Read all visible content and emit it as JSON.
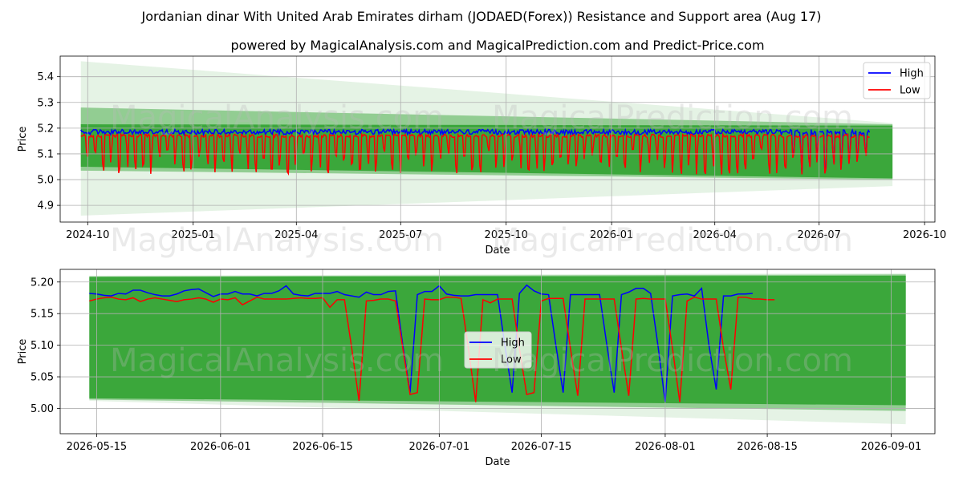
{
  "title": "Jordanian dinar With United Arab Emirates dirham (JODAED(Forex)) Resistance and Support area (Aug 17)",
  "subtitle": "powered by MagicalAnalysis.com and MagicalPrediction.com and Predict-Price.com",
  "watermarks": [
    "MagicalAnalysis.com",
    "MagicalPrediction.com"
  ],
  "colors": {
    "high": "#0000ff",
    "low": "#ff0000",
    "band": "#2ca02c",
    "band_light": "#d4ead4",
    "grid": "#b0b0b0"
  },
  "chart_data": [
    {
      "type": "line",
      "xlabel": "Date",
      "ylabel": "Price",
      "xlim": [
        "2024-09-07",
        "2026-10-10"
      ],
      "ylim": [
        4.835,
        5.48
      ],
      "grid": true,
      "legend_position": "top-right",
      "x_ticks": [
        "2024-10",
        "2025-01",
        "2025-04",
        "2025-07",
        "2025-10",
        "2026-01",
        "2026-04",
        "2026-07",
        "2026-10"
      ],
      "y_ticks": [
        "4.9",
        "5.0",
        "5.1",
        "5.2",
        "5.3",
        "5.4"
      ],
      "series": [
        {
          "name": "High",
          "x_start": "2024-09-25",
          "x_end": "2026-08-14",
          "typical": 5.185,
          "range": [
            5.175,
            5.21
          ]
        },
        {
          "name": "Low",
          "x_start": "2024-09-25",
          "x_end": "2026-08-14",
          "typical": 5.17,
          "range": [
            5.01,
            5.215
          ]
        }
      ],
      "bands": [
        {
          "x": [
            "2024-09-25",
            "2026-09-03"
          ],
          "upper": [
            5.46,
            5.22
          ],
          "lower": [
            4.86,
            4.975
          ],
          "style": "light"
        },
        {
          "x": [
            "2024-09-25",
            "2026-09-03"
          ],
          "upper": [
            5.28,
            5.215
          ],
          "lower": [
            5.035,
            5.0
          ],
          "style": "medium"
        },
        {
          "x": [
            "2024-09-25",
            "2026-09-03"
          ],
          "upper": [
            5.215,
            5.21
          ],
          "lower": [
            5.05,
            5.005
          ],
          "style": "dark"
        }
      ]
    },
    {
      "type": "line",
      "xlabel": "Date",
      "ylabel": "Price",
      "xlim": [
        "2026-05-10",
        "2026-09-07"
      ],
      "ylim": [
        4.96,
        5.22
      ],
      "grid": true,
      "legend_position": "center",
      "x_ticks": [
        "2026-05-15",
        "2026-06-01",
        "2026-06-15",
        "2026-07-01",
        "2026-07-15",
        "2026-08-01",
        "2026-08-15",
        "2026-09-01"
      ],
      "y_ticks": [
        "5.00",
        "5.05",
        "5.10",
        "5.15",
        "5.20"
      ],
      "x_start": "2026-05-14",
      "series": [
        {
          "name": "High",
          "values": [
            5.182,
            5.181,
            5.179,
            5.178,
            5.182,
            5.181,
            5.187,
            5.187,
            5.183,
            5.18,
            5.178,
            5.178,
            5.181,
            5.186,
            5.188,
            5.189,
            5.183,
            5.177,
            5.181,
            5.181,
            5.185,
            5.181,
            5.181,
            5.178,
            5.182,
            5.182,
            5.186,
            5.194,
            5.181,
            5.179,
            5.178,
            5.182,
            5.182,
            5.182,
            5.185,
            5.18,
            5.178,
            5.176,
            5.184,
            5.18,
            5.18,
            5.185,
            5.186,
            5.1,
            5.025,
            5.18,
            5.185,
            5.185,
            5.194,
            5.181,
            5.179,
            5.178,
            5.178,
            5.18,
            5.18,
            5.18,
            5.18,
            5.1,
            5.025,
            5.182,
            5.195,
            5.186,
            5.181,
            5.18,
            5.1,
            5.025,
            5.18,
            5.18,
            5.18,
            5.18,
            5.18,
            5.1,
            5.025,
            5.18,
            5.184,
            5.19,
            5.19,
            5.182,
            5.1,
            5.01,
            5.178,
            5.18,
            5.181,
            5.178,
            5.19,
            5.1,
            5.03,
            5.178,
            5.178,
            5.181,
            5.181,
            5.182
          ]
        },
        {
          "name": "Low",
          "values": [
            5.17,
            5.173,
            5.175,
            5.176,
            5.173,
            5.172,
            5.175,
            5.169,
            5.173,
            5.175,
            5.173,
            5.171,
            5.169,
            5.172,
            5.173,
            5.175,
            5.173,
            5.168,
            5.173,
            5.172,
            5.175,
            5.164,
            5.17,
            5.176,
            5.173,
            5.173,
            5.173,
            5.173,
            5.174,
            5.175,
            5.174,
            5.174,
            5.175,
            5.16,
            5.172,
            5.172,
            5.095,
            5.012,
            5.17,
            5.171,
            5.173,
            5.173,
            5.17,
            5.095,
            5.022,
            5.025,
            5.173,
            5.172,
            5.172,
            5.176,
            5.176,
            5.174,
            5.095,
            5.01,
            5.172,
            5.167,
            5.173,
            5.173,
            5.173,
            5.095,
            5.022,
            5.025,
            5.17,
            5.174,
            5.174,
            5.174,
            5.095,
            5.02,
            5.173,
            5.173,
            5.173,
            5.173,
            5.173,
            5.095,
            5.02,
            5.173,
            5.174,
            5.173,
            5.173,
            5.173,
            5.095,
            5.01,
            5.17,
            5.176,
            5.173,
            5.173,
            5.173,
            5.095,
            5.03,
            5.176,
            5.176,
            5.173,
            5.173,
            5.172,
            5.172
          ]
        }
      ],
      "bands": [
        {
          "x": [
            "2026-05-14",
            "2026-09-03"
          ],
          "upper": [
            5.21,
            5.214
          ],
          "lower": [
            5.012,
            4.975
          ],
          "style": "light"
        },
        {
          "x": [
            "2026-05-14",
            "2026-09-03"
          ],
          "upper": [
            5.209,
            5.212
          ],
          "lower": [
            5.014,
            4.996
          ],
          "style": "medium"
        },
        {
          "x": [
            "2026-05-14",
            "2026-09-03"
          ],
          "upper": [
            5.208,
            5.21
          ],
          "lower": [
            5.016,
            5.005
          ],
          "style": "dark"
        }
      ]
    }
  ]
}
